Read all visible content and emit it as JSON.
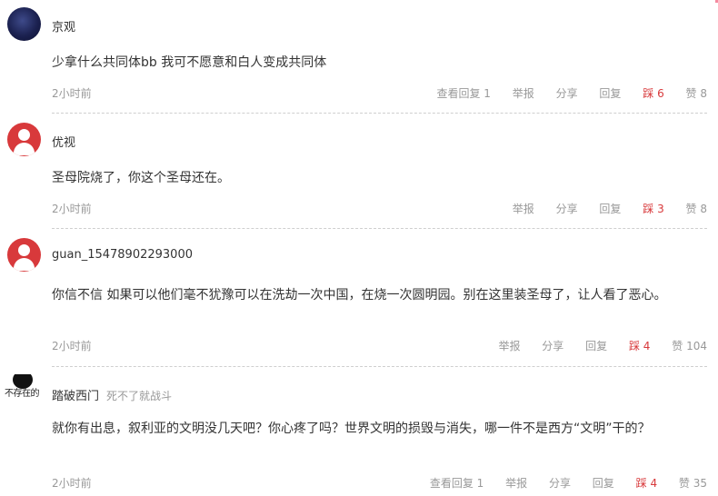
{
  "comments": [
    {
      "user": "京观",
      "signature": "",
      "avatar": "space-avatar",
      "text": "少拿什么共同体bb 我可不愿意和白人变成共同体",
      "time": "2小时前",
      "view_replies": "查看回复 1",
      "report": "举报",
      "share": "分享",
      "reply": "回复",
      "downvote": "踩 6",
      "upvote": "赞 8"
    },
    {
      "user": "优视",
      "signature": "",
      "avatar": "default-avatar",
      "text": "圣母院烧了，你这个圣母还在。",
      "time": "2小时前",
      "report": "举报",
      "share": "分享",
      "reply": "回复",
      "downvote": "踩 3",
      "upvote": "赞 8"
    },
    {
      "user": "guan_15478902293000",
      "signature": "",
      "avatar": "default-avatar",
      "text": "你信不信 如果可以他们毫不犹豫可以在洗劫一次中国，在烧一次圆明园。别在这里装圣母了，让人看了恶心。",
      "time": "2小时前",
      "report": "举报",
      "share": "分享",
      "reply": "回复",
      "downvote": "踩 4",
      "upvote": "赞 104"
    },
    {
      "user": "踏破西门",
      "signature": "死不了就战斗",
      "avatar": "text-avatar",
      "avatar_text": "不存在的",
      "text": "就你有出息，叙利亚的文明没几天吧？你心疼了吗？世界文明的损毁与消失，哪一件不是西方“文明”干的？",
      "time": "2小时前",
      "view_replies": "查看回复 1",
      "report": "举报",
      "share": "分享",
      "reply": "回复",
      "downvote": "踩 4",
      "upvote": "赞 35"
    }
  ],
  "colors": {
    "downvote": "#d8393b",
    "meta": "#999999",
    "text": "#333333"
  }
}
